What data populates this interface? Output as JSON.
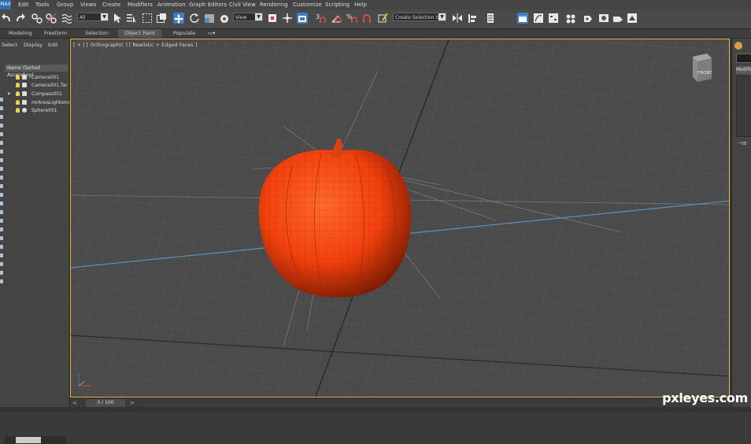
{
  "menu": {
    "logo": "MAX",
    "items": [
      "Edit",
      "Tools",
      "Group",
      "Views",
      "Create",
      "Modifiers",
      "Animation",
      "Graph Editors",
      "Civil View",
      "Rendering",
      "Customize",
      "Scripting",
      "Help"
    ]
  },
  "toolbar": {
    "filter_value": "All",
    "refcoord_value": "View",
    "selection_set_value": "Create Selection Se"
  },
  "ribbon": {
    "tabs": [
      "Modeling",
      "Freeform",
      "Selection",
      "Object Paint",
      "Populate"
    ],
    "selected": "Object Paint"
  },
  "scene_explorer": {
    "tabs": [
      "Select",
      "Display",
      "Edit"
    ],
    "header": "Name (Sorted Ascending)",
    "items": [
      {
        "name": "Camera001",
        "icon": "camera-icon"
      },
      {
        "name": "Camera001.Tar",
        "icon": "target-icon"
      },
      {
        "name": "Compass001",
        "icon": "compass-icon"
      },
      {
        "name": "mrAreaLightomn",
        "icon": "light-icon"
      },
      {
        "name": "Sphere001",
        "icon": "sphere-icon"
      }
    ]
  },
  "viewport": {
    "label": "[ + ] [ Orthographic ] [ Realistic + Edged Faces ]",
    "viewcube_label": "FRONT",
    "object_color": "#ff4a12",
    "accent_color": "#e6b73a"
  },
  "command_panel": {
    "modifier_list": "Modifier"
  },
  "timeline": {
    "frame": "0 / 100"
  },
  "watermark": "pxleyes.com"
}
